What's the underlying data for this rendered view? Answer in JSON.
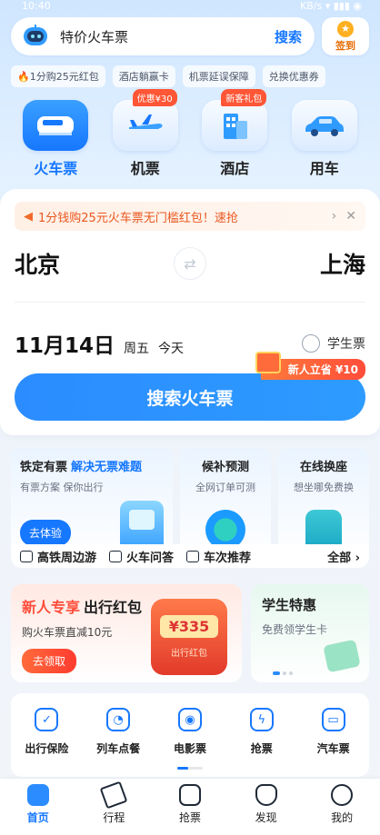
{
  "statusbar": {
    "time": "10:40",
    "right": "KB/s ▾ ▮▮▮ ◉"
  },
  "search": {
    "placeholder": "特价火车票",
    "button": "搜索"
  },
  "signin": {
    "label": "签到"
  },
  "chips": [
    {
      "label": "1分购25元红包"
    },
    {
      "label": "酒店躺赢卡"
    },
    {
      "label": "机票延误保障"
    },
    {
      "label": "兑换优惠券"
    }
  ],
  "categories": [
    {
      "label": "火车票",
      "badge": "",
      "icon": "train-icon"
    },
    {
      "label": "机票",
      "badge": "优惠¥30",
      "icon": "plane-icon"
    },
    {
      "label": "酒店",
      "badge": "新客礼包",
      "icon": "hotel-icon"
    },
    {
      "label": "用车",
      "badge": "",
      "icon": "car-icon"
    }
  ],
  "booking": {
    "promo": "1分钱购25元火车票无门槛红包！速抢",
    "from_city": "北京",
    "to_city": "上海",
    "date": "11月14日",
    "weekday": "周五",
    "relative": "今天",
    "student_label": "学生票",
    "search_label": "搜索火车票",
    "newbie_tag": "新人立省 ¥10"
  },
  "features": {
    "guarantee": {
      "title": "铁定有票",
      "highlight": "解决无票难题",
      "sub": "有票方案 保你出行",
      "button": "去体验"
    },
    "waitlist": {
      "title": "候补预测",
      "sub": "全网订单可测"
    },
    "seatswap": {
      "title": "在线换座",
      "sub": "想坐哪免费换"
    }
  },
  "quick_links": [
    {
      "label": "高铁周边游"
    },
    {
      "label": "火车问答"
    },
    {
      "label": "车次推荐"
    }
  ],
  "quick_all": "全部 ›",
  "promo_red": {
    "title_red": "新人专享",
    "title": "出行红包",
    "sub": "购火车票直减10元",
    "button": "去领取",
    "amount": "¥335",
    "envelope_label": "出行红包"
  },
  "promo_student": {
    "title": "学生特惠",
    "sub": "免费领学生卡"
  },
  "services": [
    {
      "label": "出行保险",
      "glyph": "✓"
    },
    {
      "label": "列车点餐",
      "glyph": "◔"
    },
    {
      "label": "电影票",
      "glyph": "◉"
    },
    {
      "label": "抢票",
      "glyph": "ϟ"
    },
    {
      "label": "汽车票",
      "glyph": "▭"
    }
  ],
  "bottom_nav": [
    {
      "label": "首页"
    },
    {
      "label": "行程"
    },
    {
      "label": "抢票"
    },
    {
      "label": "发现"
    },
    {
      "label": "我的"
    }
  ],
  "colors": {
    "accent": "#1677ff",
    "promo": "#ff4d3a"
  }
}
